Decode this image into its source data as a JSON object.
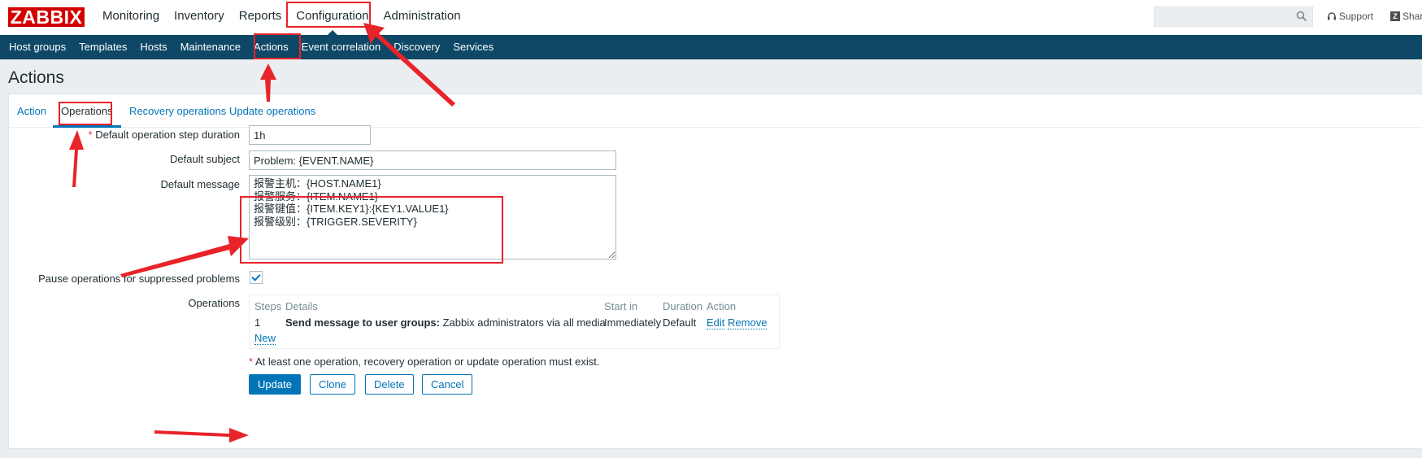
{
  "logo": "ZABBIX",
  "main_menu": [
    "Monitoring",
    "Inventory",
    "Reports",
    "Configuration",
    "Administration"
  ],
  "search": {
    "placeholder": ""
  },
  "header_links": {
    "support": "Support",
    "share": "Share"
  },
  "sub_menu": [
    "Host groups",
    "Templates",
    "Hosts",
    "Maintenance",
    "Actions",
    "Event correlation",
    "Discovery",
    "Services"
  ],
  "page_title": "Actions",
  "tabs": [
    "Action",
    "Operations",
    "Recovery operations",
    "Update operations"
  ],
  "form": {
    "step_duration_label": "Default operation step duration",
    "step_duration_required": "*",
    "step_duration_value": "1h",
    "subject_label": "Default subject",
    "subject_value": "Problem: {EVENT.NAME}",
    "message_label": "Default message",
    "message_value": "报警主机：{HOST.NAME1}\n报警服务：{ITEM.NAME1}\n报警键值：{ITEM.KEY1}:{KEY1.VALUE1}\n报警级别：{TRIGGER.SEVERITY}",
    "pause_label": "Pause operations for suppressed problems",
    "pause_checked": true,
    "operations_label": "Operations"
  },
  "operations_table": {
    "headers": {
      "steps": "Steps",
      "details": "Details",
      "start_in": "Start in",
      "duration": "Duration",
      "action": "Action"
    },
    "rows": [
      {
        "step": "1",
        "details_bold": "Send message to user groups:",
        "details_rest": " Zabbix administrators via all media",
        "start_in": "Immediately",
        "duration": "Default",
        "edit": "Edit",
        "remove": "Remove"
      }
    ],
    "new_link": "New"
  },
  "warning": {
    "asterisk": "*",
    "text": " At least one operation, recovery operation or update operation must exist."
  },
  "buttons": {
    "update": "Update",
    "clone": "Clone",
    "delete": "Delete",
    "cancel": "Cancel"
  },
  "colors": {
    "brand_red": "#d40000",
    "nav_blue": "#0e4866",
    "link_blue": "#0275b8",
    "annotation_red": "#e8232a"
  }
}
